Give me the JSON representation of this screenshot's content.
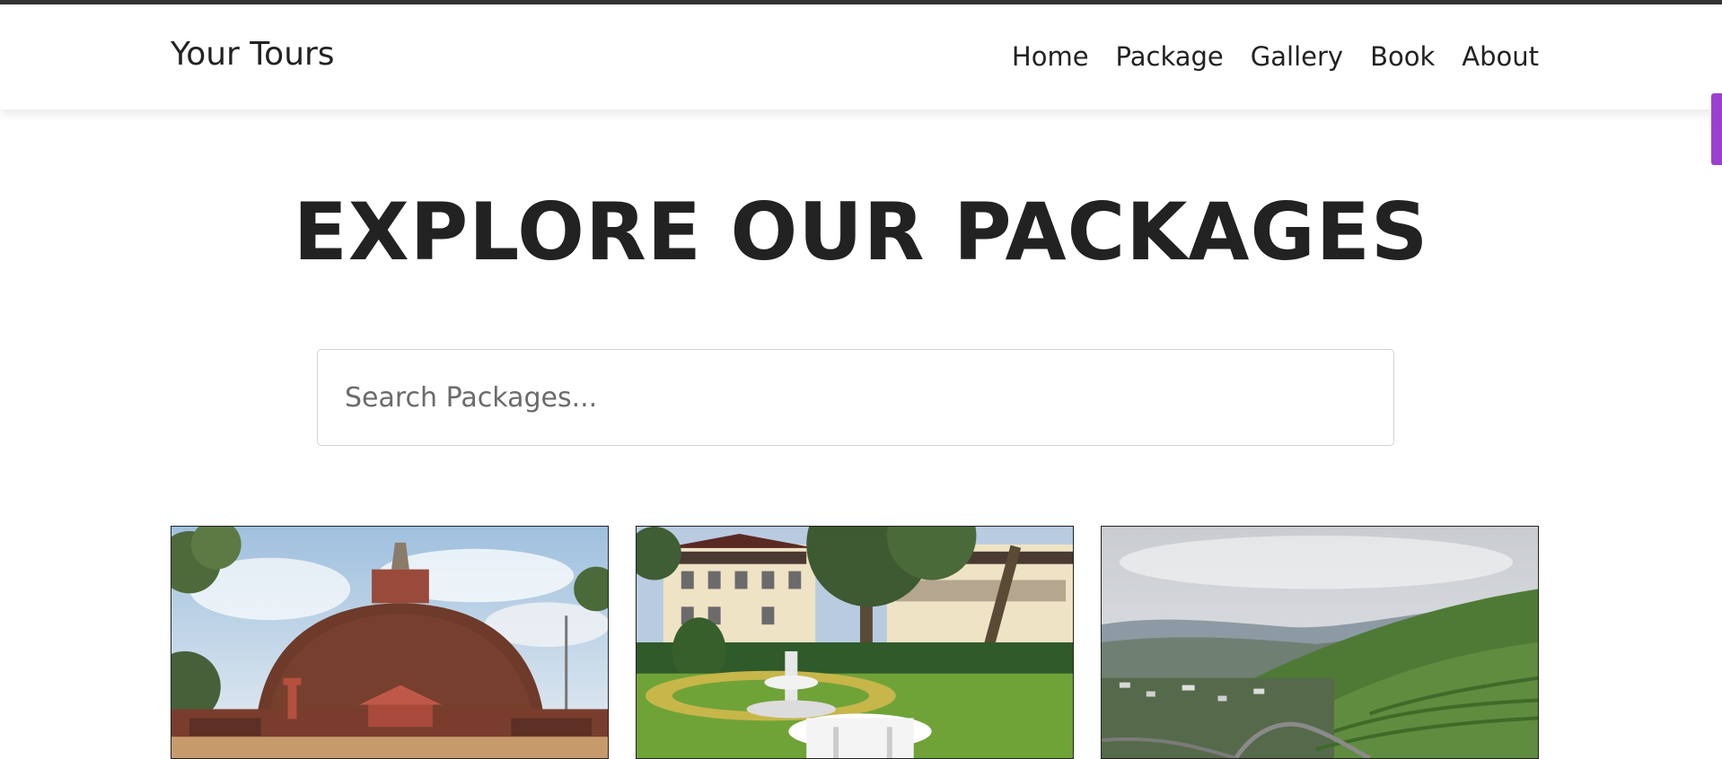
{
  "brand": "Your Tours",
  "nav": {
    "items": [
      "Home",
      "Package",
      "Gallery",
      "Book",
      "About"
    ]
  },
  "main": {
    "title": "EXPLORE OUR PACKAGES",
    "search": {
      "placeholder": "Search Packages...",
      "value": ""
    }
  },
  "packages": [
    {
      "image": "dome-stupa-photo"
    },
    {
      "image": "garden-hotel-photo"
    },
    {
      "image": "tea-hills-photo"
    }
  ],
  "colors": {
    "accent": "#9b3fd1",
    "text": "#222222",
    "top_strip": "#333333"
  }
}
